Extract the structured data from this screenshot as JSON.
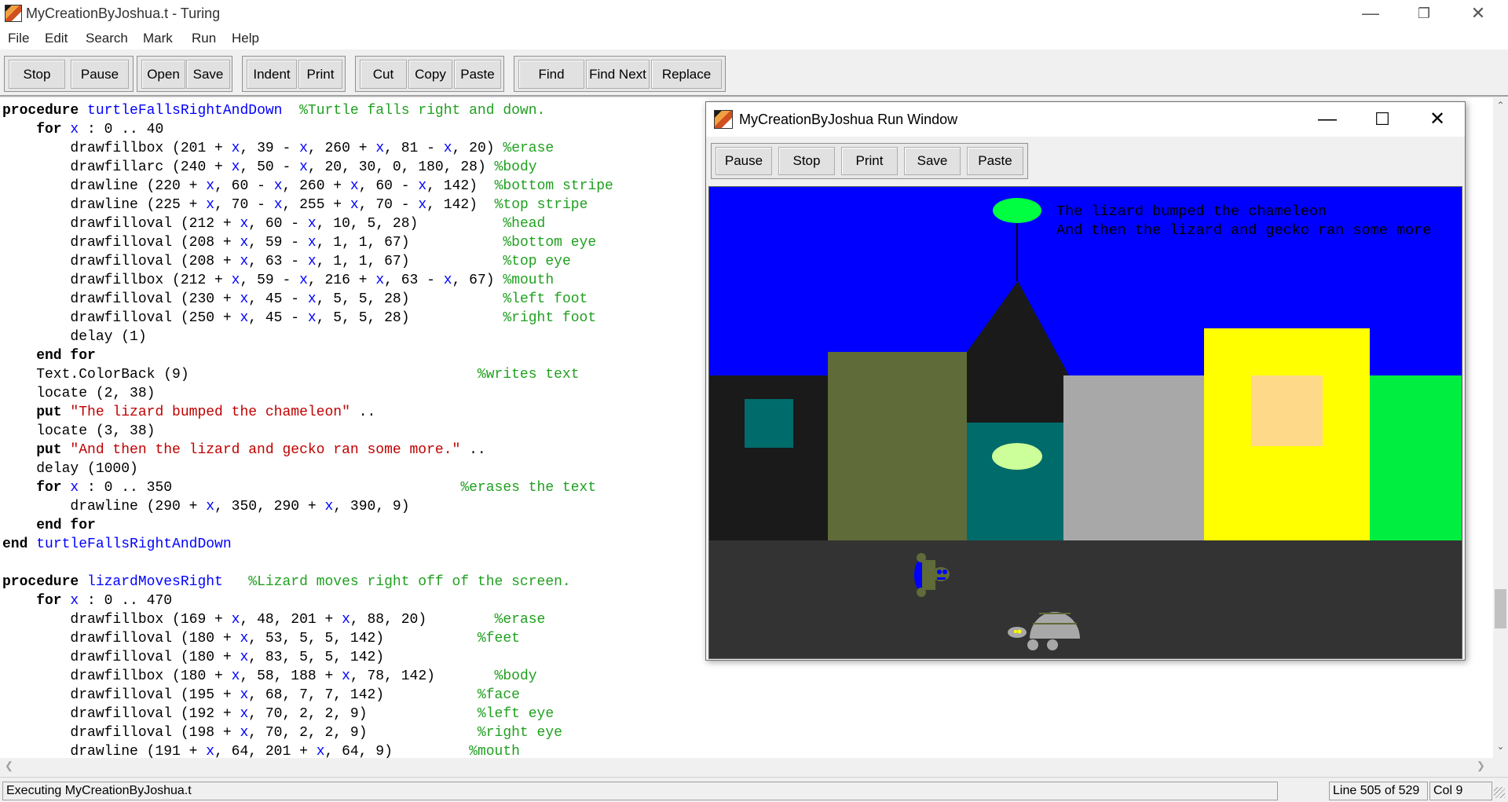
{
  "window": {
    "title": "MyCreationByJoshua.t - Turing",
    "controls": [
      "minimize",
      "restore",
      "close"
    ]
  },
  "menu": [
    "File",
    "Edit",
    "Search",
    "Mark",
    "Run",
    "Help"
  ],
  "toolbar": {
    "stop": "Stop",
    "pause": "Pause",
    "open": "Open",
    "save": "Save",
    "indent": "Indent",
    "print": "Print",
    "cut": "Cut",
    "copy": "Copy",
    "paste": "Paste",
    "find": "Find",
    "find_next": "Find Next",
    "replace": "Replace"
  },
  "code": {
    "l01": [
      "procedure ",
      "turtleFallsRightAndDown",
      "  %Turtle falls right and down."
    ],
    "l02": [
      "    for ",
      "x",
      " : 0 .. 40"
    ],
    "l03": [
      "        drawfillbox (201 + ",
      "x",
      ", 39 - ",
      "x",
      ", 260 + ",
      "x",
      ", 81 - ",
      "x",
      ", 20) ",
      "%erase"
    ],
    "l04": [
      "        drawfillarc (240 + ",
      "x",
      ", 50 - ",
      "x",
      ", 20, 30, 0, 180, 28) ",
      "%body"
    ],
    "l05": [
      "        drawline (220 + ",
      "x",
      ", 60 - ",
      "x",
      ", 260 + ",
      "x",
      ", 60 - ",
      "x",
      ", 142)  ",
      "%bottom stripe"
    ],
    "l06": [
      "        drawline (225 + ",
      "x",
      ", 70 - ",
      "x",
      ", 255 + ",
      "x",
      ", 70 - ",
      "x",
      ", 142)  ",
      "%top stripe"
    ],
    "l07": [
      "        drawfilloval (212 + ",
      "x",
      ", 60 - ",
      "x",
      ", 10, 5, 28)          ",
      "%head"
    ],
    "l08": [
      "        drawfilloval (208 + ",
      "x",
      ", 59 - ",
      "x",
      ", 1, 1, 67)           ",
      "%bottom eye"
    ],
    "l09": [
      "        drawfilloval (208 + ",
      "x",
      ", 63 - ",
      "x",
      ", 1, 1, 67)           ",
      "%top eye"
    ],
    "l10": [
      "        drawfillbox (212 + ",
      "x",
      ", 59 - ",
      "x",
      ", 216 + ",
      "x",
      ", 63 - ",
      "x",
      ", 67) ",
      "%mouth"
    ],
    "l11": [
      "        drawfilloval (230 + ",
      "x",
      ", 45 - ",
      "x",
      ", 5, 5, 28)           ",
      "%left foot"
    ],
    "l12": [
      "        drawfilloval (250 + ",
      "x",
      ", 45 - ",
      "x",
      ", 5, 5, 28)           ",
      "%right foot"
    ],
    "l13": [
      "        delay (1)"
    ],
    "l14": [
      "    end for"
    ],
    "l15": [
      "    Text.ColorBack (9)                                  ",
      "%writes text"
    ],
    "l16": [
      "    locate (2, 38)"
    ],
    "l17": [
      "    put ",
      "\"The lizard bumped the chameleon\"",
      " .."
    ],
    "l18": [
      "    locate (3, 38)"
    ],
    "l19": [
      "    put ",
      "\"And then the lizard and gecko ran some more.\"",
      " .."
    ],
    "l20": [
      "    delay (1000)"
    ],
    "l21": [
      "    for ",
      "x",
      " : 0 .. 350                                  ",
      "%erases the text"
    ],
    "l22": [
      "        drawline (290 + ",
      "x",
      ", 350, 290 + ",
      "x",
      ", 390, 9)"
    ],
    "l23": [
      "    end for"
    ],
    "l24": [
      "end ",
      "turtleFallsRightAndDown"
    ],
    "l26": [
      "procedure ",
      "lizardMovesRight",
      "   %Lizard moves right off of the screen."
    ],
    "l27": [
      "    for ",
      "x",
      " : 0 .. 470"
    ],
    "l28": [
      "        drawfillbox (169 + ",
      "x",
      ", 48, 201 + ",
      "x",
      ", 88, 20)        ",
      "%erase"
    ],
    "l29": [
      "        drawfilloval (180 + ",
      "x",
      ", 53, 5, 5, 142)           ",
      "%feet"
    ],
    "l30": [
      "        drawfilloval (180 + ",
      "x",
      ", 83, 5, 5, 142)"
    ],
    "l31": [
      "        drawfillbox (180 + ",
      "x",
      ", 58, 188 + ",
      "x",
      ", 78, 142)       ",
      "%body"
    ],
    "l32": [
      "        drawfilloval (195 + ",
      "x",
      ", 68, 7, 7, 142)           ",
      "%face"
    ],
    "l33": [
      "        drawfilloval (192 + ",
      "x",
      ", 70, 2, 2, 9)             ",
      "%left eye"
    ],
    "l34": [
      "        drawfilloval (198 + ",
      "x",
      ", 70, 2, 2, 9)             ",
      "%right eye"
    ],
    "l35": [
      "        drawline (191 + ",
      "x",
      ", 64, 201 + ",
      "x",
      ", 64, 9)         ",
      "%mouth"
    ]
  },
  "run_window": {
    "title": "MyCreationByJoshua Run Window",
    "buttons": {
      "pause": "Pause",
      "stop": "Stop",
      "print": "Print",
      "save": "Save",
      "paste": "Paste"
    },
    "output_line1": "The lizard bumped the chameleon",
    "output_line2": "And then the lizard and gecko ran some more"
  },
  "status": {
    "message": "Executing MyCreationByJoshua.t",
    "line": "Line 505 of 529",
    "col": "Col 9"
  },
  "colors": {
    "sky": "#0000ff",
    "sun": "#00ff40",
    "building_dark": "#1a1a1a",
    "building_olive": "#5f6b38",
    "building_teal": "#006b6b",
    "building_gray": "#a8a8a8",
    "building_yellow": "#ffff00",
    "window_peach": "#ffd98a",
    "grass": "#00ee40",
    "road": "#333333",
    "keyword": "#000000",
    "identifier": "#0000ff",
    "comment": "#20a020",
    "string": "#c00000"
  }
}
